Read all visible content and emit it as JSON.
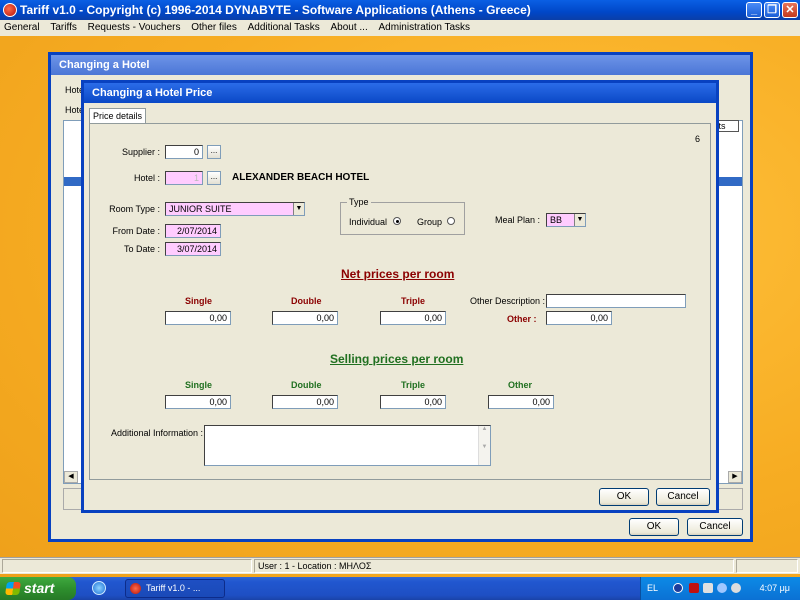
{
  "app": {
    "title": "Tariff  v1.0   -   Copyright (c) 1996-2014  DYNABYTE - Software Applications (Athens - Greece)",
    "menu": [
      "General",
      "Tariffs",
      "Requests - Vouchers",
      "Other files",
      "Additional Tasks",
      "About ...",
      "Administration Tasks"
    ]
  },
  "hotel_dialog": {
    "title": "Changing a Hotel",
    "label_hotel": "Hotel",
    "label_hotel2": "Hotel",
    "right_tab": "ents",
    "ok": "OK",
    "cancel": "Cancel"
  },
  "price_dialog": {
    "title": "Changing a Hotel Price",
    "tab": "Price details",
    "record_no": "6",
    "supplier_label": "Supplier :",
    "supplier_value": "0",
    "hotel_label": "Hotel :",
    "hotel_value": "1",
    "hotel_name": "ALEXANDER BEACH HOTEL",
    "browse": "...",
    "room_type_label": "Room Type :",
    "room_type_value": "JUNIOR SUITE",
    "from_date_label": "From Date :",
    "from_date_value": "2/07/2014",
    "to_date_label": "To Date :",
    "to_date_value": "3/07/2014",
    "type_group_label": "Type",
    "type_individual": "Individual",
    "type_group": "Group",
    "meal_plan_label": "Meal Plan :",
    "meal_plan_value": "BB",
    "net_heading": "Net prices per room",
    "net_single": "Single",
    "net_double": "Double",
    "net_triple": "Triple",
    "other_desc_label": "Other Description :",
    "other_desc_value": "",
    "net_other_label": "Other :",
    "net_single_value": "0,00",
    "net_double_value": "0,00",
    "net_triple_value": "0,00",
    "net_other_value": "0,00",
    "sell_heading": "Selling prices per room",
    "sell_single": "Single",
    "sell_double": "Double",
    "sell_triple": "Triple",
    "sell_other": "Other",
    "sell_single_value": "0,00",
    "sell_double_value": "0,00",
    "sell_triple_value": "0,00",
    "sell_other_value": "0,00",
    "additional_info_label": "Additional Information :",
    "additional_info_value": "",
    "ok": "OK",
    "cancel": "Cancel"
  },
  "statusbar": {
    "user": "User : 1  -  Location : ΜΗΛΟΣ"
  },
  "taskbar": {
    "start": "start",
    "task_item": "Tariff  v1.0  -   ...",
    "lang": "EL",
    "clock": "4:07 μμ"
  },
  "colors": {
    "net_heading": "#8b0000",
    "sell_heading": "#207020",
    "pink_field": "#ffccff"
  }
}
